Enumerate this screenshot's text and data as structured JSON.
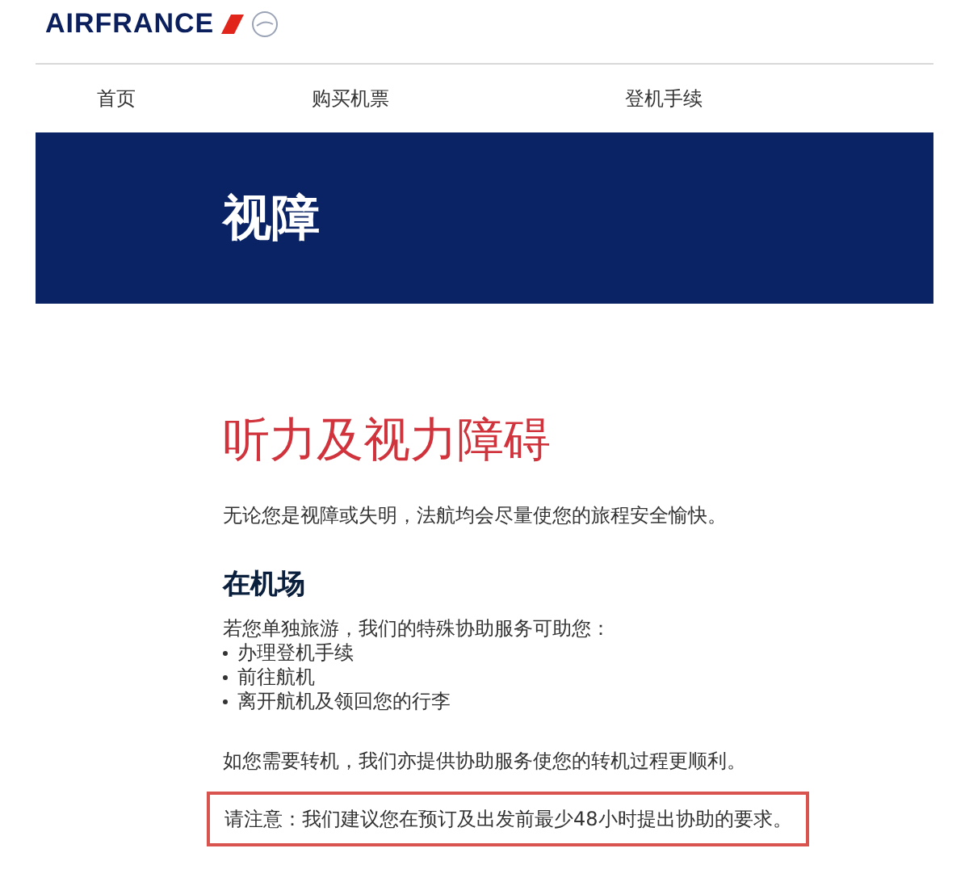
{
  "logo": {
    "text": "AIRFRANCE"
  },
  "nav": [
    {
      "label": "首页"
    },
    {
      "label": "购买机票"
    },
    {
      "label": "登机手续"
    }
  ],
  "banner": {
    "title": "视障"
  },
  "heading": "听力及视力障碍",
  "intro": "无论您是视障或失明，法航均会尽量使您的旅程安全愉快。",
  "section": {
    "title": "在机场",
    "lead": "若您单独旅游，我们的特殊协助服务可助您：",
    "items": [
      "办理登机手续",
      "前往航机",
      "离开航机及领回您的行李"
    ]
  },
  "transfer": "如您需要转机，我们亦提供协助服务使您的转机过程更顺利。",
  "note": {
    "text": "请注意：我们建议您在预订及出发前最少48小时提出协助的要求。",
    "highlighted": true
  }
}
